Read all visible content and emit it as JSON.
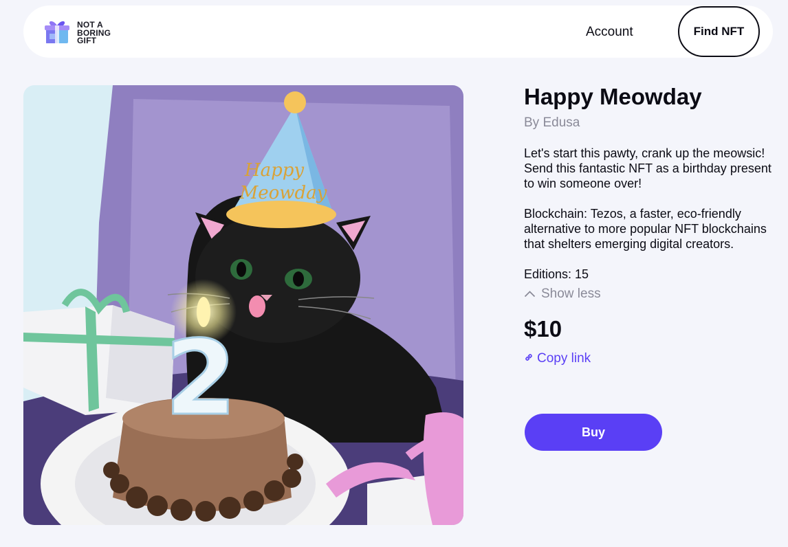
{
  "header": {
    "logo": {
      "line1": "NOT A",
      "line2": "BORING",
      "line3": "GIFT",
      "icon": "gift-box-icon"
    },
    "nav_account": "Account",
    "find_button": "Find NFT"
  },
  "artwork": {
    "alt": "Cat in a party hat with a birthday cake",
    "hat_text_line1": "Happy",
    "hat_text_line2": "Meowday",
    "candle_number": "2"
  },
  "product": {
    "title": "Happy Meowday",
    "author": "By Edusa",
    "description": "Let's start this pawty, crank up the meowsic! Send this fantastic NFT as a birthday present to win someone over!",
    "blockchain": "Blockchain: Tezos, a faster, eco-friendly alternative to more popular NFT blockchains that shelters emerging digital creators.",
    "editions": "Editions: 15",
    "toggle_label": "Show less",
    "toggle_icon": "chevron-up-icon",
    "price": "$10",
    "copy_link": "Copy link",
    "copy_icon": "link-icon",
    "buy_button": "Buy"
  },
  "colors": {
    "accent": "#5a3ff5",
    "background": "#f4f5fb",
    "muted": "#8a8a98"
  }
}
